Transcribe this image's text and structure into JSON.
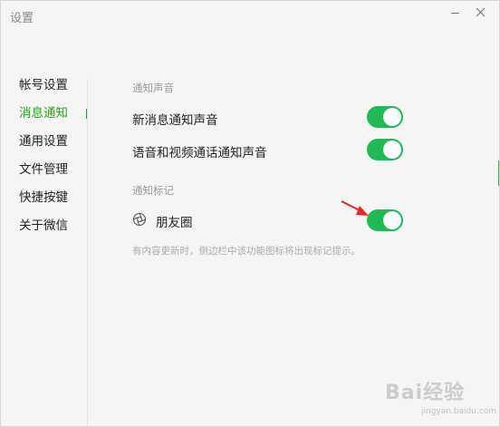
{
  "window": {
    "title": "设置"
  },
  "sidebar": {
    "items": [
      {
        "label": "帐号设置"
      },
      {
        "label": "消息通知"
      },
      {
        "label": "通用设置"
      },
      {
        "label": "文件管理"
      },
      {
        "label": "快捷按键"
      },
      {
        "label": "关于微信"
      }
    ],
    "active_index": 1
  },
  "notification_sound": {
    "section_label": "通知声音",
    "new_message_sound": {
      "label": "新消息通知声音",
      "enabled": true
    },
    "voice_video_sound": {
      "label": "语音和视频通话通知声音",
      "enabled": true
    }
  },
  "notification_badge": {
    "section_label": "通知标记",
    "moments": {
      "label": "朋友圈",
      "enabled": true,
      "icon": "moments-icon"
    },
    "hint": "有内容更新时，侧边栏中该功能图标将出现标记提示。"
  },
  "colors": {
    "accent": "#1aad19",
    "toggle_on": "#1fb955",
    "annotation_arrow": "#e8262a"
  },
  "watermark": {
    "main": "Bai经验",
    "sub": "jingyan.baidu.com"
  }
}
